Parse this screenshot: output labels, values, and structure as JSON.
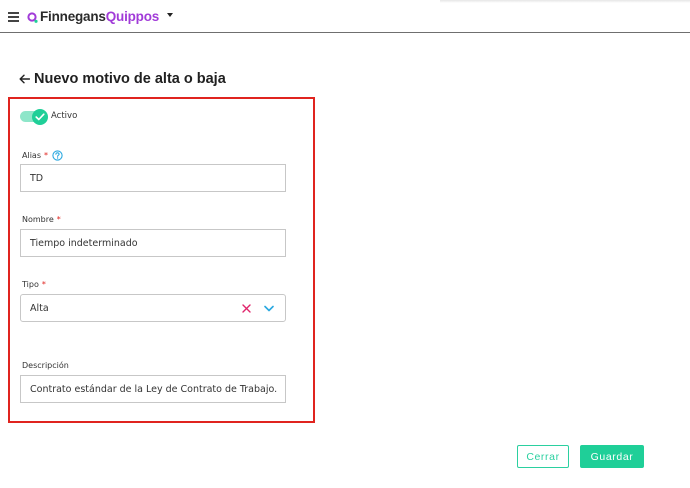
{
  "header": {
    "app_name_part1": "Finnegans",
    "app_name_part2": "Quippos",
    "icons": [
      "menu-icon",
      "logo-icon",
      "caret-down-icon"
    ]
  },
  "page": {
    "title": "Nuevo motivo de alta o baja"
  },
  "form": {
    "active_toggle": {
      "label": "Activo",
      "checked": true
    },
    "alias": {
      "label": "Alias",
      "required": "*",
      "value": "TD"
    },
    "nombre": {
      "label": "Nombre",
      "required": "*",
      "value": "Tiempo indeterminado"
    },
    "tipo": {
      "label": "Tipo",
      "required": "*",
      "selected": "Alta"
    },
    "descripcion": {
      "label": "Descripción",
      "value": "Contrato estándar de la Ley de Contrato de Trabajo."
    }
  },
  "actions": {
    "cerrar_label": "Cerrar",
    "guardar_label": "Guardar"
  },
  "colors": {
    "accent": "#1fcf98",
    "brand_purple": "#a13bd8",
    "required": "#e0241f",
    "highlight_border": "#e0241f",
    "help_icon": "#2aa8e0",
    "clear_icon": "#e0246b"
  }
}
